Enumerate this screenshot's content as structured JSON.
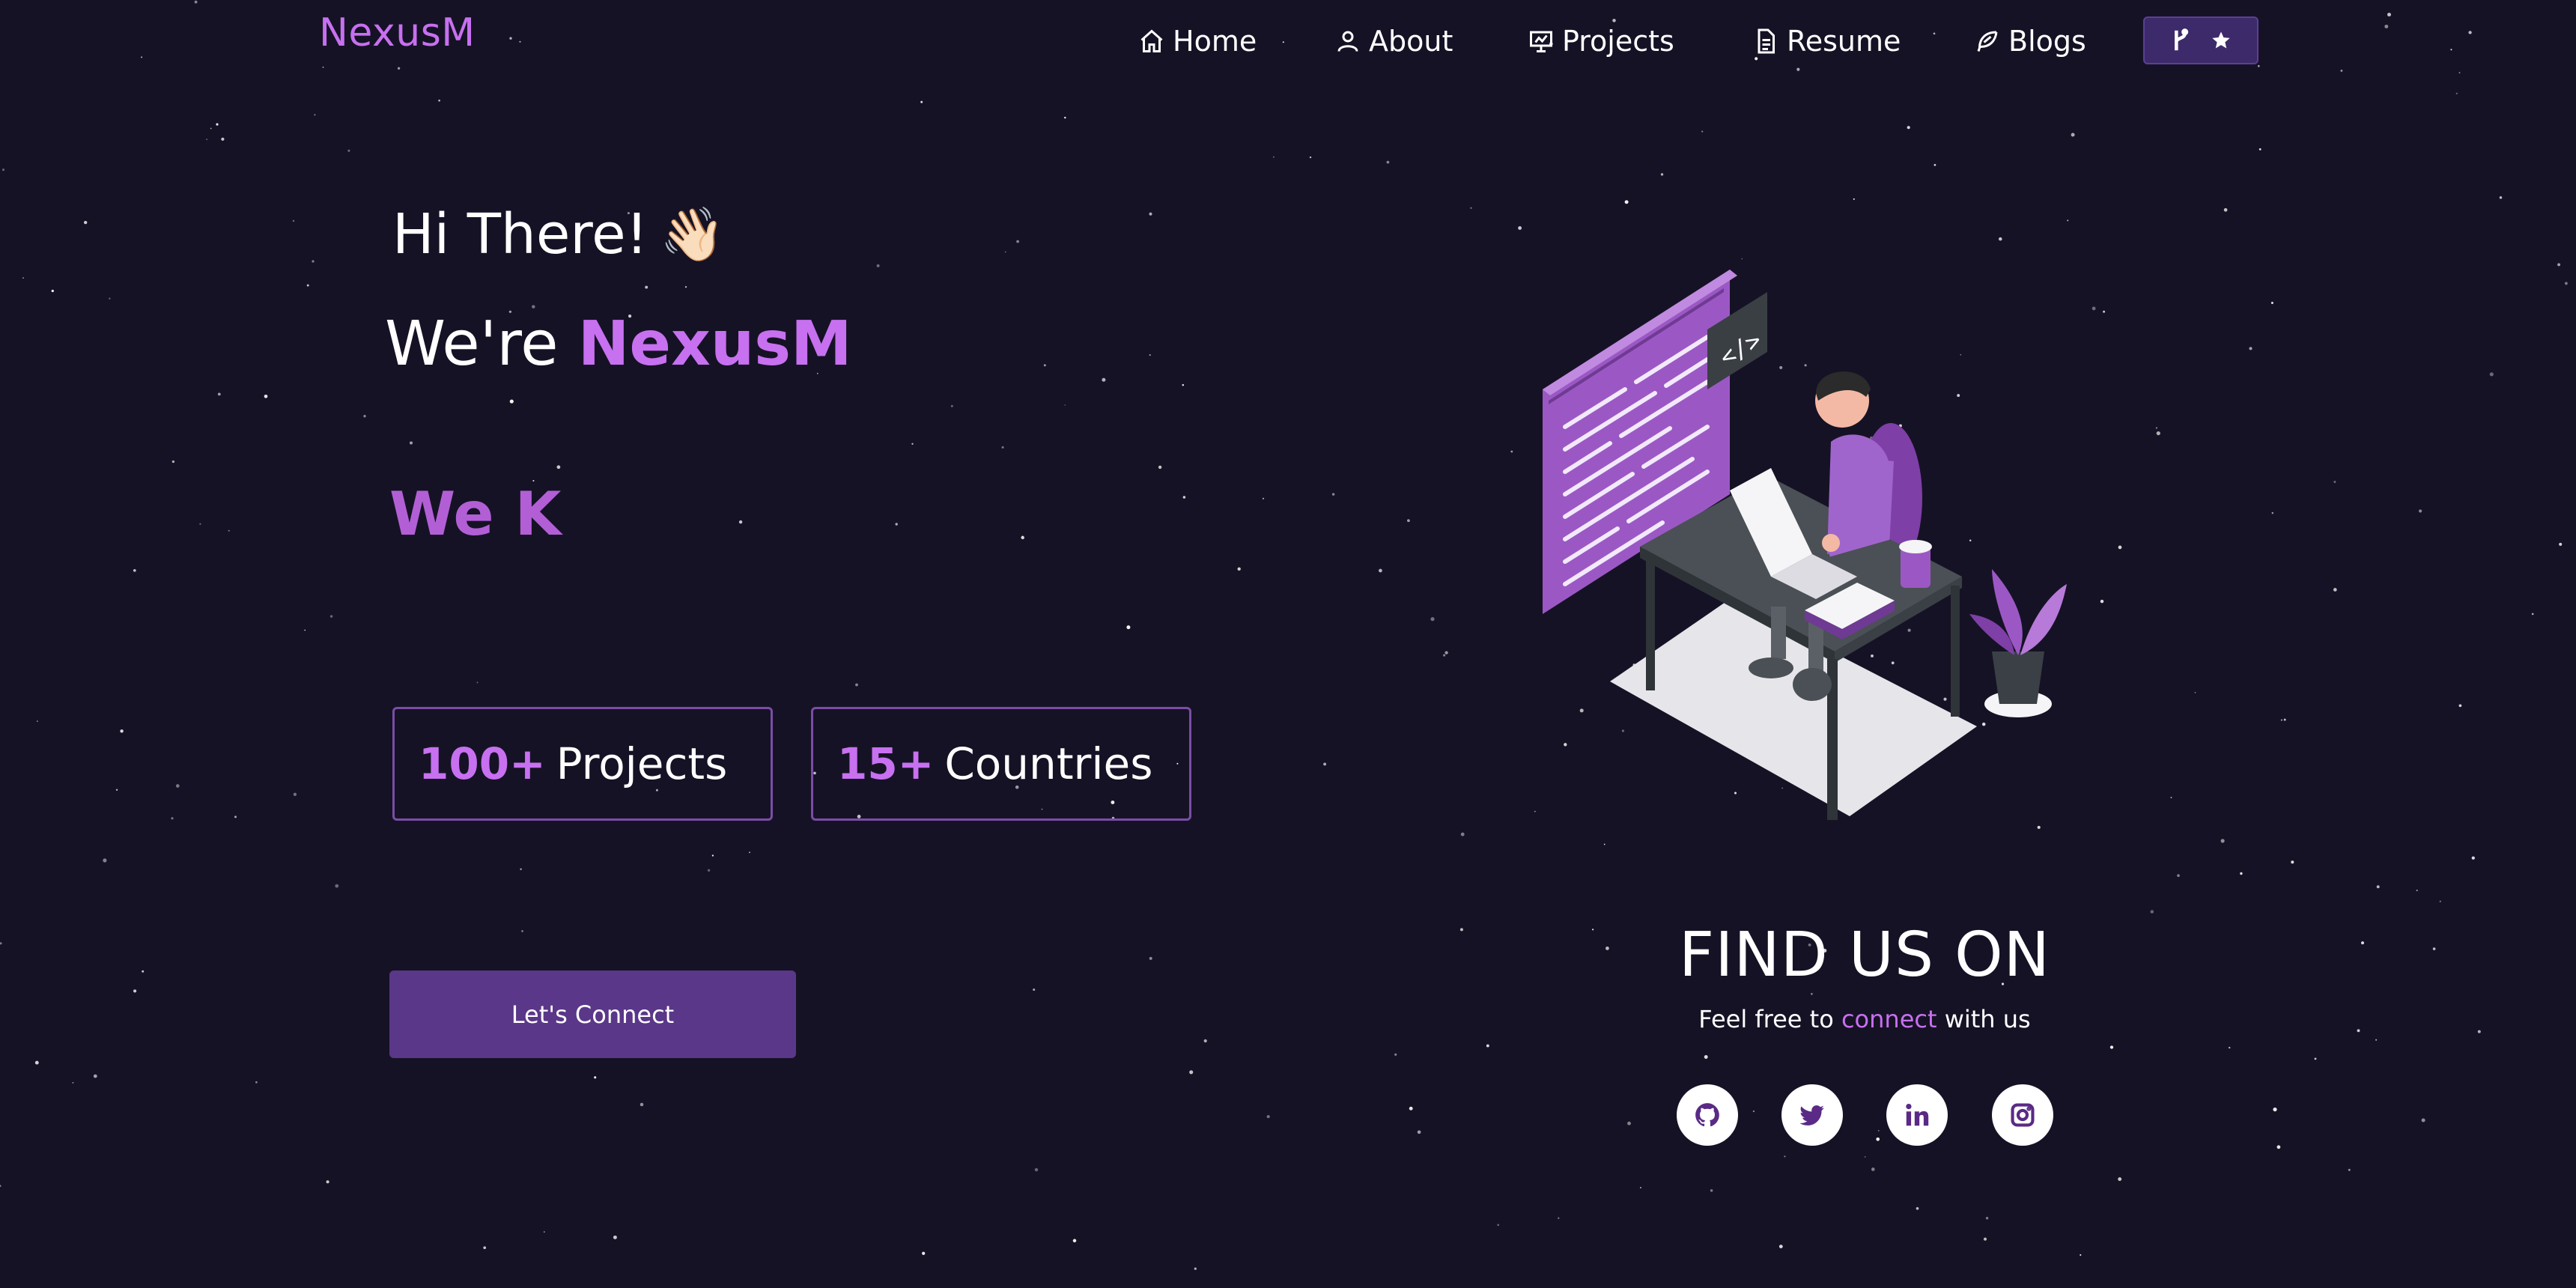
{
  "nav": {
    "brand": "NexusM",
    "items": [
      {
        "label": "Home",
        "icon": "home-icon"
      },
      {
        "label": "About",
        "icon": "user-icon"
      },
      {
        "label": "Projects",
        "icon": "presentation-icon"
      },
      {
        "label": "Resume",
        "icon": "document-icon"
      },
      {
        "label": "Blogs",
        "icon": "feather-icon"
      }
    ],
    "fork_button_icons": [
      "git-fork-icon",
      "star-icon"
    ]
  },
  "hero": {
    "greeting": "Hi There!",
    "wave_emoji": "👋🏻",
    "intro_prefix": "We're",
    "intro_name": "NexusM",
    "typed_text": "We K",
    "stats": [
      {
        "number": "100+",
        "label": "Projects"
      },
      {
        "number": "15+",
        "label": "Countries"
      }
    ],
    "connect_button": "Let's Connect"
  },
  "find_us": {
    "title": "FIND US ON",
    "subtitle_before": "Feel free to",
    "subtitle_highlight": "connect",
    "subtitle_after": "with us",
    "socials": [
      "github-icon",
      "twitter-icon",
      "linkedin-icon",
      "instagram-icon"
    ]
  },
  "colors": {
    "background": "#161225",
    "accent": "#c770f0",
    "button": "#5a3788",
    "stat_border": "#7a4da6"
  }
}
